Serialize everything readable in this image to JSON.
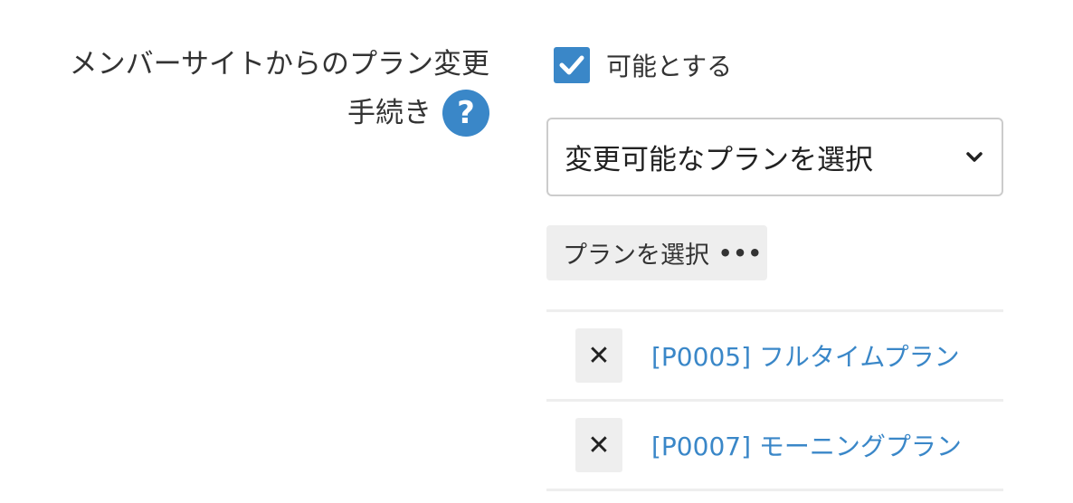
{
  "label": {
    "line1": "メンバーサイトからのプラン変更",
    "line2": "手続き",
    "help_icon": "question-icon",
    "help_glyph": "?"
  },
  "checkbox": {
    "checked": true,
    "label": "可能とする"
  },
  "select": {
    "value": "変更可能なプランを選択"
  },
  "plan_button": {
    "label": "プランを選択",
    "icon": "ellipsis-icon",
    "glyph": "•••"
  },
  "plans": [
    {
      "label": "[P0005] フルタイムプラン",
      "remove_glyph": "✕"
    },
    {
      "label": "[P0007] モーニングプラン",
      "remove_glyph": "✕"
    }
  ],
  "colors": {
    "accent": "#3a87c8",
    "button_bg": "#eeeeee",
    "border": "#cccccc"
  }
}
